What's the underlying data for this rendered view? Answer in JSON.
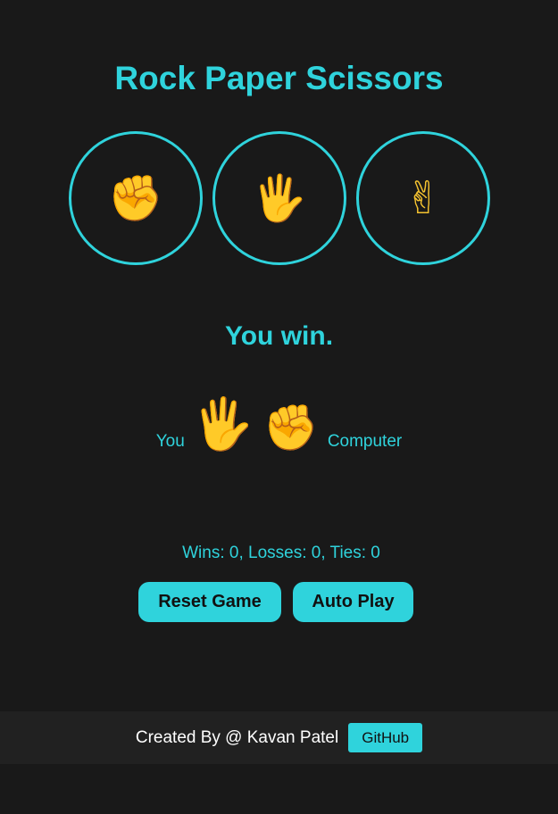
{
  "header": {
    "title": "Rock Paper Scissors"
  },
  "choices": [
    {
      "name": "rock",
      "icon": "raised-fist-icon",
      "glyph": "✊"
    },
    {
      "name": "paper",
      "icon": "raised-hand-icon",
      "glyph": "🖐"
    },
    {
      "name": "scissors",
      "icon": "victory-hand-icon",
      "glyph": "✌"
    }
  ],
  "result": {
    "text": "You win."
  },
  "moves": {
    "player_label": "You",
    "player_move": "paper",
    "player_glyph": "🖐",
    "computer_move": "rock",
    "computer_glyph": "✊",
    "computer_label": "Computer"
  },
  "score": {
    "text": "Wins: 0, Losses: 0, Ties: 0"
  },
  "controls": {
    "reset_label": "Reset Game",
    "auto_label": "Auto Play"
  },
  "footer": {
    "credit": "Created By @ Kavan Patel",
    "github_label": "GitHub"
  },
  "colors": {
    "background": "#191919",
    "accent": "#2fd3dc",
    "footer_bg": "#212121",
    "emoji": "#f5c330"
  }
}
